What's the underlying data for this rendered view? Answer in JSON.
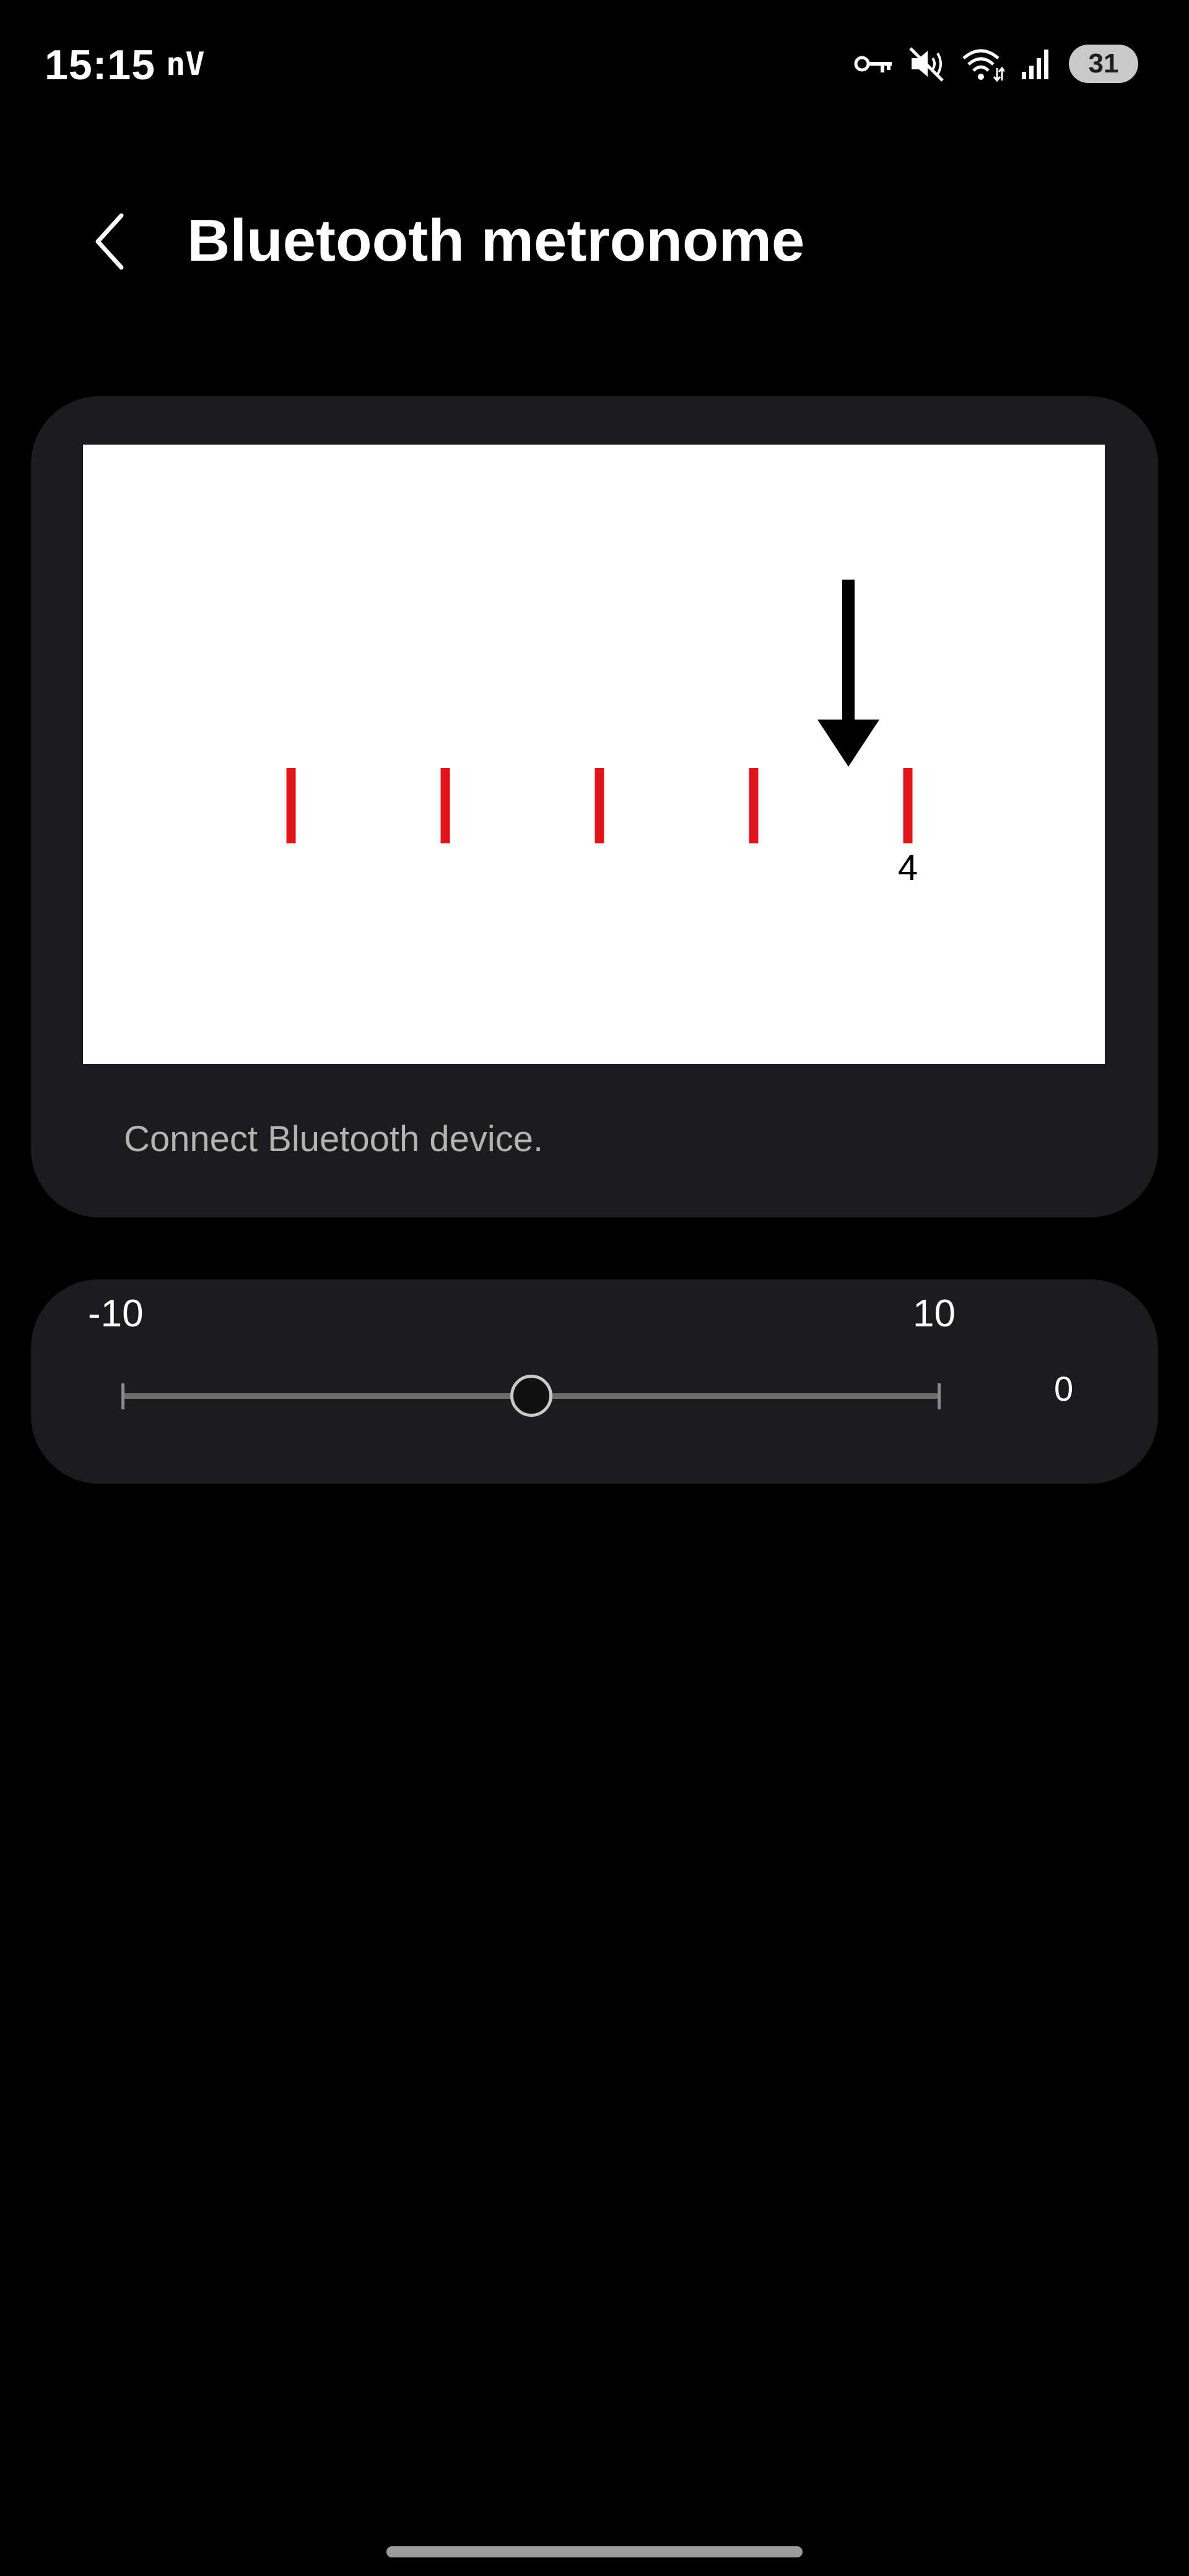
{
  "status_bar": {
    "time": "15:15",
    "carrier_glyph": "nV",
    "icons": [
      "vpn-key-icon",
      "mute-icon",
      "wifi-icon",
      "signal-icon"
    ],
    "battery": "31"
  },
  "header": {
    "back_icon": "chevron-left-icon",
    "title": "Bluetooth metronome"
  },
  "metronome": {
    "tick_count": 5,
    "active_beat_index": 4,
    "beat_number": "4",
    "tick_color": "#e0141b",
    "arrow_color": "#000000",
    "caption": "Connect Bluetooth device."
  },
  "offset_slider": {
    "min_label": "-10",
    "max_label": "10",
    "min": -10,
    "max": 10,
    "value": 0,
    "value_label": "0"
  },
  "colors": {
    "background": "#000000",
    "card": "#1c1c1e",
    "accent_tick": "#e0141b"
  }
}
